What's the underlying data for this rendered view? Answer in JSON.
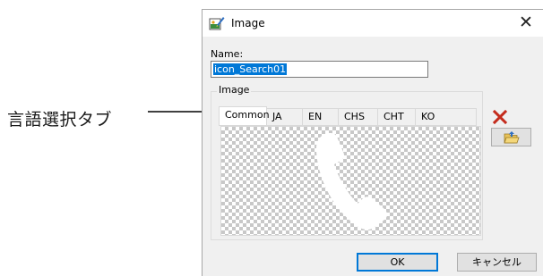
{
  "annotation": {
    "label": "言語選択タブ"
  },
  "dialog": {
    "title": "Image",
    "title_icon": "image-edit-icon",
    "close_glyph": "✕",
    "name_label": "Name:",
    "name_value": "icon_Search01",
    "group_label": "Image",
    "tabs": [
      {
        "label": "Common",
        "active": true
      },
      {
        "label": "JA",
        "active": false
      },
      {
        "label": "EN",
        "active": false
      },
      {
        "label": "CHS",
        "active": false
      },
      {
        "label": "CHT",
        "active": false
      },
      {
        "label": "KO",
        "active": false
      }
    ],
    "preview_icon": "phone-handset-icon",
    "delete_icon": "red-x-icon",
    "open_icon": "open-folder-icon",
    "ok_label": "OK",
    "cancel_label": "キャンセル"
  },
  "colors": {
    "selection": "#0078d7",
    "delete_red": "#c42b1c",
    "checker_dark": "#c8c8c8"
  }
}
